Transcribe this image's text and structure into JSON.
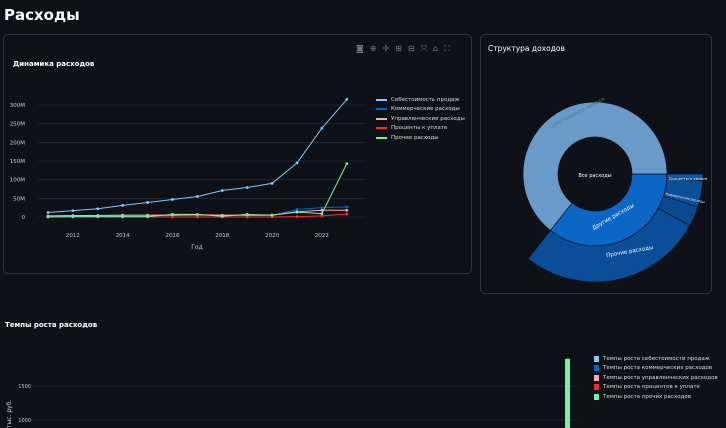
{
  "page_title": "Расходы",
  "toolbar": [
    "camera-icon",
    "zoom-icon",
    "pan-icon",
    "zoom-in-icon",
    "zoom-out-icon",
    "autoscale-icon",
    "home-icon",
    "fullscreen-icon"
  ],
  "chart_data": [
    {
      "type": "line",
      "title": "Динамика расходов",
      "xlabel": "Год",
      "ylabel": "",
      "x": [
        2011,
        2012,
        2013,
        2014,
        2015,
        2016,
        2017,
        2018,
        2019,
        2020,
        2021,
        2022,
        2023
      ],
      "xticks": [
        "2012",
        "2014",
        "2016",
        "2018",
        "2020",
        "2022"
      ],
      "yticks": [
        "0",
        "50M",
        "100M",
        "150M",
        "200M",
        "250M",
        "300M"
      ],
      "ylim": [
        0,
        320
      ],
      "y_unit": "M",
      "grid": true,
      "legend": "right",
      "series": [
        {
          "name": "Себестоимость продаж",
          "color": "#83c9ff",
          "values": [
            12,
            17,
            22,
            31,
            39,
            47,
            55,
            71,
            79,
            90,
            145,
            238,
            315
          ]
        },
        {
          "name": "Коммерческие расходы",
          "color": "#0068c9",
          "values": [
            1,
            2,
            2,
            3,
            3,
            4,
            5,
            4,
            4,
            4,
            20,
            25,
            27
          ]
        },
        {
          "name": "Управленческие  расходы",
          "color": "#ffabab",
          "values": [
            3,
            4,
            4,
            5,
            5,
            5,
            6,
            5,
            5,
            5,
            14,
            18,
            18
          ]
        },
        {
          "name": "Проценты к уплате",
          "color": "#ff2b2b",
          "values": [
            0,
            0,
            0,
            0,
            0,
            0,
            0,
            0,
            0,
            0,
            1,
            3,
            8
          ]
        },
        {
          "name": "Прочие  расходы",
          "color": "#7defa1",
          "values": [
            0,
            1,
            1,
            1,
            1,
            7,
            7,
            2,
            7,
            5,
            13,
            9,
            143
          ]
        }
      ]
    },
    {
      "type": "sunburst",
      "title": "Структура доходов",
      "root": "Все расходы",
      "children": [
        {
          "name": "Себестоимость продаж",
          "value": 65,
          "color": "#6a9ac8"
        },
        {
          "name": "Другие расходы",
          "value": 36,
          "color": "#0b66c6",
          "children": [
            {
              "name": "Проценты к уплате",
              "value": 1,
              "color": "#0d57a8"
            },
            {
              "name": "Коммерческие расходы",
              "value": 4,
              "color": "#0b4f99"
            },
            {
              "name": "Управленческие расходы",
              "value": 3,
              "color": "#0a4a8f"
            },
            {
              "name": "Прочие расходы",
              "value": 28,
              "color": "#0a4d99"
            }
          ]
        }
      ]
    },
    {
      "type": "bar",
      "title": "Темпы роста расходов",
      "ylabel": "тыс. руб.",
      "yticks": [
        "1000",
        "1500"
      ],
      "legend": "right",
      "series": [
        {
          "name": "Темпы роста себестоимости продаж",
          "color": "#83c9ff"
        },
        {
          "name": "Темпы роста коммерческих расходов",
          "color": "#0068c9"
        },
        {
          "name": "Темпы роста управленческих расходов",
          "color": "#ffabab"
        },
        {
          "name": "Темпы роста процентов к уплате",
          "color": "#ff2b2b"
        },
        {
          "name": "Темпы роста прочих расходов",
          "color": "#7defa1",
          "visible_bar_value": 1900
        }
      ]
    }
  ]
}
